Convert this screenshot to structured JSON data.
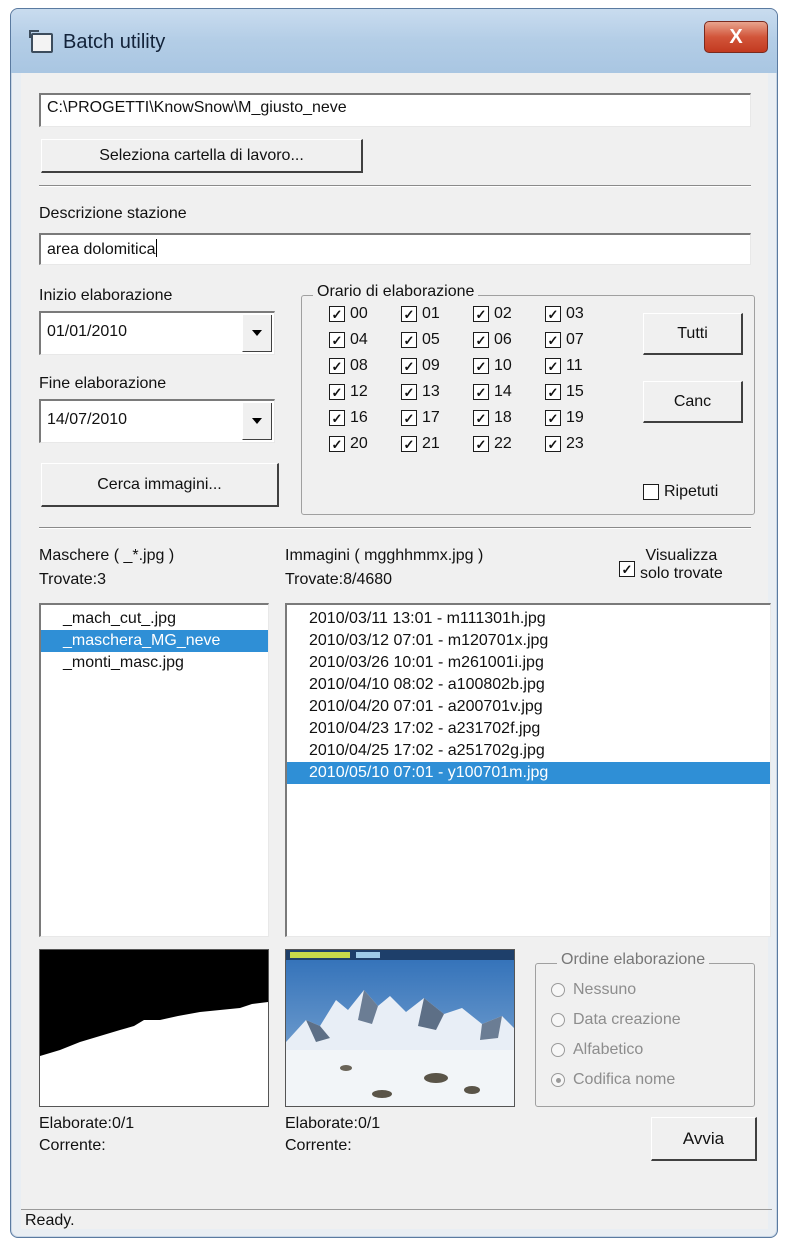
{
  "window": {
    "title": "Batch utility",
    "close_glyph": "X"
  },
  "workdir": {
    "path": "C:\\PROGETTI\\KnowSnow\\M_giusto_neve",
    "select_button": "Seleziona cartella di lavoro..."
  },
  "station": {
    "label": "Descrizione stazione",
    "value": "area dolomitica"
  },
  "dates": {
    "start_label": "Inizio elaborazione",
    "start_value": "01/01/2010",
    "end_label": "Fine elaborazione",
    "end_value": "14/07/2010",
    "search_button": "Cerca immagini..."
  },
  "hours": {
    "title": "Orario di elaborazione",
    "items": [
      "00",
      "01",
      "02",
      "03",
      "04",
      "05",
      "06",
      "07",
      "08",
      "09",
      "10",
      "11",
      "12",
      "13",
      "14",
      "15",
      "16",
      "17",
      "18",
      "19",
      "20",
      "21",
      "22",
      "23"
    ],
    "all_checked": true,
    "all_button": "Tutti",
    "clear_button": "Canc",
    "repeat_label": "Ripetuti",
    "repeat_checked": false
  },
  "masks": {
    "label": "Maschere ( _*.jpg )",
    "found": "Trovate:3",
    "items": [
      "_mach_cut_.jpg",
      "_maschera_MG_neve",
      "_monti_masc.jpg"
    ],
    "selected_index": 1,
    "processed": "Elaborate:0/1",
    "current": "Corrente:"
  },
  "images": {
    "label": "Immagini ( mgghhmmx.jpg )",
    "found": "Trovate:8/4680",
    "show_only_found_line1": "Visualizza",
    "show_only_found_line2": "solo trovate",
    "show_only_found_checked": true,
    "items": [
      "2010/03/11 13:01 - m111301h.jpg",
      "2010/03/12 07:01 - m120701x.jpg",
      "2010/03/26 10:01 - m261001i.jpg",
      "2010/04/10 08:02 - a100802b.jpg",
      "2010/04/20 07:01 - a200701v.jpg",
      "2010/04/23 17:02 - a231702f.jpg",
      "2010/04/25 17:02 - a251702g.jpg",
      "2010/05/10 07:01 - y100701m.jpg"
    ],
    "selected_index": 7,
    "processed": "Elaborate:0/1",
    "current": "Corrente:"
  },
  "order": {
    "title": "Ordine elaborazione",
    "options": [
      "Nessuno",
      "Data creazione",
      "Alfabetico",
      "Codifica nome"
    ],
    "selected_index": 3
  },
  "run_button": "Avvia",
  "status": "Ready."
}
